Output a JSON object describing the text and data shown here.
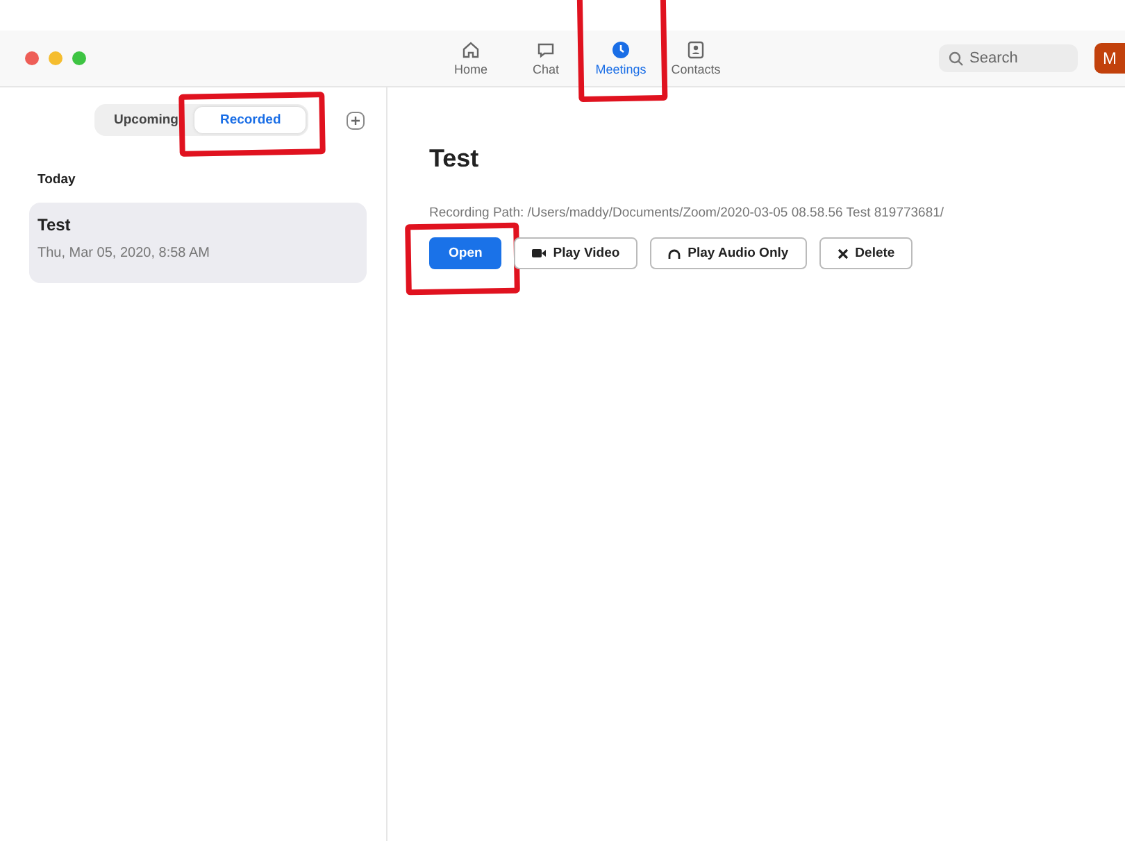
{
  "nav": [
    {
      "label": "Home",
      "selected": false,
      "highlighted": false
    },
    {
      "label": "Chat",
      "selected": false,
      "highlighted": false
    },
    {
      "label": "Meetings",
      "selected": true,
      "highlighted": true
    },
    {
      "label": "Contacts",
      "selected": false,
      "highlighted": false
    }
  ],
  "search": {
    "placeholder": "Search"
  },
  "avatar": {
    "initial": "M"
  },
  "tabs": [
    {
      "label": "Upcoming",
      "selected": false,
      "highlighted": false
    },
    {
      "label": "Recorded",
      "selected": true,
      "highlighted": true
    }
  ],
  "section": "Today",
  "recordings": [
    {
      "title": "Test",
      "date": "Thu, Mar 05, 2020, 8:58 AM",
      "selected": true
    }
  ],
  "detail": {
    "title": "Test",
    "path": "Recording Path: /Users/maddy/Documents/Zoom/2020-03-05 08.58.56 Test 819773681/",
    "buttons": [
      {
        "label": "Open",
        "kind": "primary",
        "highlighted": true
      },
      {
        "label": "Play Video",
        "kind": "secondary",
        "highlighted": false
      },
      {
        "label": "Play Audio Only",
        "kind": "secondary",
        "highlighted": false
      },
      {
        "label": "Delete",
        "kind": "secondary",
        "highlighted": false
      }
    ]
  }
}
